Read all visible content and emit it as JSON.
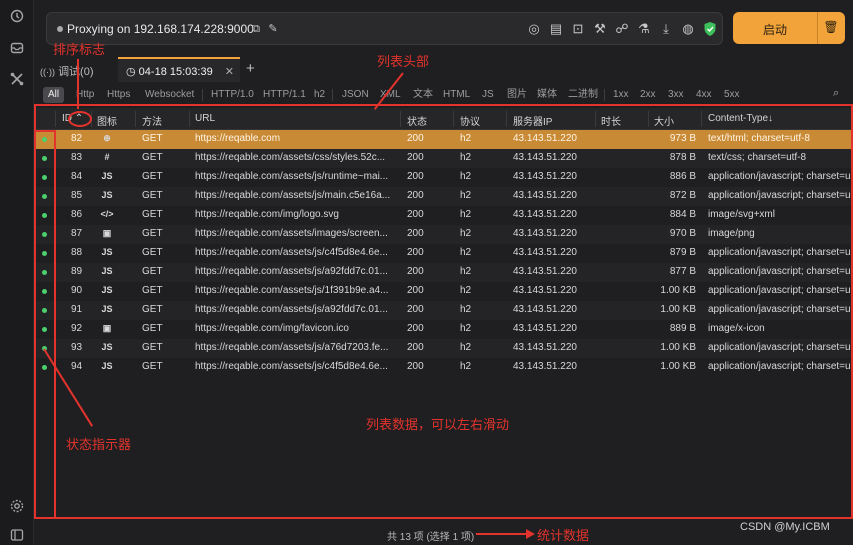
{
  "rail": {
    "icons": [
      "history-icon",
      "inbox-icon",
      "tools-icon",
      "settings-icon",
      "sidebar-icon"
    ]
  },
  "topbar": {
    "proxy_text": "Proxying on 192.168.174.228:9000",
    "start_label": "启动"
  },
  "tabs": [
    {
      "label": "调试(0)"
    },
    {
      "label": "04-18 15:03:39"
    }
  ],
  "filters": [
    "All",
    "Http",
    "Https",
    "Websocket",
    "HTTP/1.0",
    "HTTP/1.1",
    "h2",
    "JSON",
    "XML",
    "文本",
    "HTML",
    "JS",
    "图片",
    "媒体",
    "二进制",
    "1xx",
    "2xx",
    "3xx",
    "4xx",
    "5xx"
  ],
  "columns": [
    "ID",
    "图标",
    "方法",
    "URL",
    "状态",
    "协议",
    "服务器IP",
    "时长",
    "大小",
    "Content-Type"
  ],
  "rows": [
    {
      "id": "82",
      "icon": "⊕",
      "method": "GET",
      "url": "https://reqable.com",
      "status": "200",
      "proto": "h2",
      "ip": "43.143.51.220",
      "size": "973 B",
      "ctype": "text/html; charset=utf-8"
    },
    {
      "id": "83",
      "icon": "#",
      "method": "GET",
      "url": "https://reqable.com/assets/css/styles.52c...",
      "status": "200",
      "proto": "h2",
      "ip": "43.143.51.220",
      "size": "878 B",
      "ctype": "text/css; charset=utf-8"
    },
    {
      "id": "84",
      "icon": "JS",
      "method": "GET",
      "url": "https://reqable.com/assets/js/runtime~mai...",
      "status": "200",
      "proto": "h2",
      "ip": "43.143.51.220",
      "size": "886 B",
      "ctype": "application/javascript; charset=u"
    },
    {
      "id": "85",
      "icon": "JS",
      "method": "GET",
      "url": "https://reqable.com/assets/js/main.c5e16a...",
      "status": "200",
      "proto": "h2",
      "ip": "43.143.51.220",
      "size": "872 B",
      "ctype": "application/javascript; charset=u"
    },
    {
      "id": "86",
      "icon": "</>",
      "method": "GET",
      "url": "https://reqable.com/img/logo.svg",
      "status": "200",
      "proto": "h2",
      "ip": "43.143.51.220",
      "size": "884 B",
      "ctype": "image/svg+xml"
    },
    {
      "id": "87",
      "icon": "▣",
      "method": "GET",
      "url": "https://reqable.com/assets/images/screen...",
      "status": "200",
      "proto": "h2",
      "ip": "43.143.51.220",
      "size": "970 B",
      "ctype": "image/png"
    },
    {
      "id": "88",
      "icon": "JS",
      "method": "GET",
      "url": "https://reqable.com/assets/js/c4f5d8e4.6e...",
      "status": "200",
      "proto": "h2",
      "ip": "43.143.51.220",
      "size": "879 B",
      "ctype": "application/javascript; charset=u"
    },
    {
      "id": "89",
      "icon": "JS",
      "method": "GET",
      "url": "https://reqable.com/assets/js/a92fdd7c.01...",
      "status": "200",
      "proto": "h2",
      "ip": "43.143.51.220",
      "size": "877 B",
      "ctype": "application/javascript; charset=u"
    },
    {
      "id": "90",
      "icon": "JS",
      "method": "GET",
      "url": "https://reqable.com/assets/js/1f391b9e.a4...",
      "status": "200",
      "proto": "h2",
      "ip": "43.143.51.220",
      "size": "1.00 KB",
      "ctype": "application/javascript; charset=u"
    },
    {
      "id": "91",
      "icon": "JS",
      "method": "GET",
      "url": "https://reqable.com/assets/js/a92fdd7c.01...",
      "status": "200",
      "proto": "h2",
      "ip": "43.143.51.220",
      "size": "1.00 KB",
      "ctype": "application/javascript; charset=u"
    },
    {
      "id": "92",
      "icon": "▣",
      "method": "GET",
      "url": "https://reqable.com/img/favicon.ico",
      "status": "200",
      "proto": "h2",
      "ip": "43.143.51.220",
      "size": "889 B",
      "ctype": "image/x-icon"
    },
    {
      "id": "93",
      "icon": "JS",
      "method": "GET",
      "url": "https://reqable.com/assets/js/a76d7203.fe...",
      "status": "200",
      "proto": "h2",
      "ip": "43.143.51.220",
      "size": "1.00 KB",
      "ctype": "application/javascript; charset=u"
    },
    {
      "id": "94",
      "icon": "JS",
      "method": "GET",
      "url": "https://reqable.com/assets/js/c4f5d8e4.6e...",
      "status": "200",
      "proto": "h2",
      "ip": "43.143.51.220",
      "size": "1.00 KB",
      "ctype": "application/javascript; charset=u"
    }
  ],
  "annotations": {
    "sort_flag": "排序标志",
    "list_header": "列表头部",
    "list_data": "列表数据，可以左右滑动",
    "status_indicator": "状态指示器",
    "stats_data": "统计数据"
  },
  "status_bar": {
    "text": "共 13 项 (选择 1 项)"
  },
  "watermark": "CSDN @My.ICBM",
  "colors": {
    "accent": "#f2a43a",
    "selected_row": "#c98a36",
    "status_dot": "#4bd06b",
    "annotation": "#e3332c"
  }
}
